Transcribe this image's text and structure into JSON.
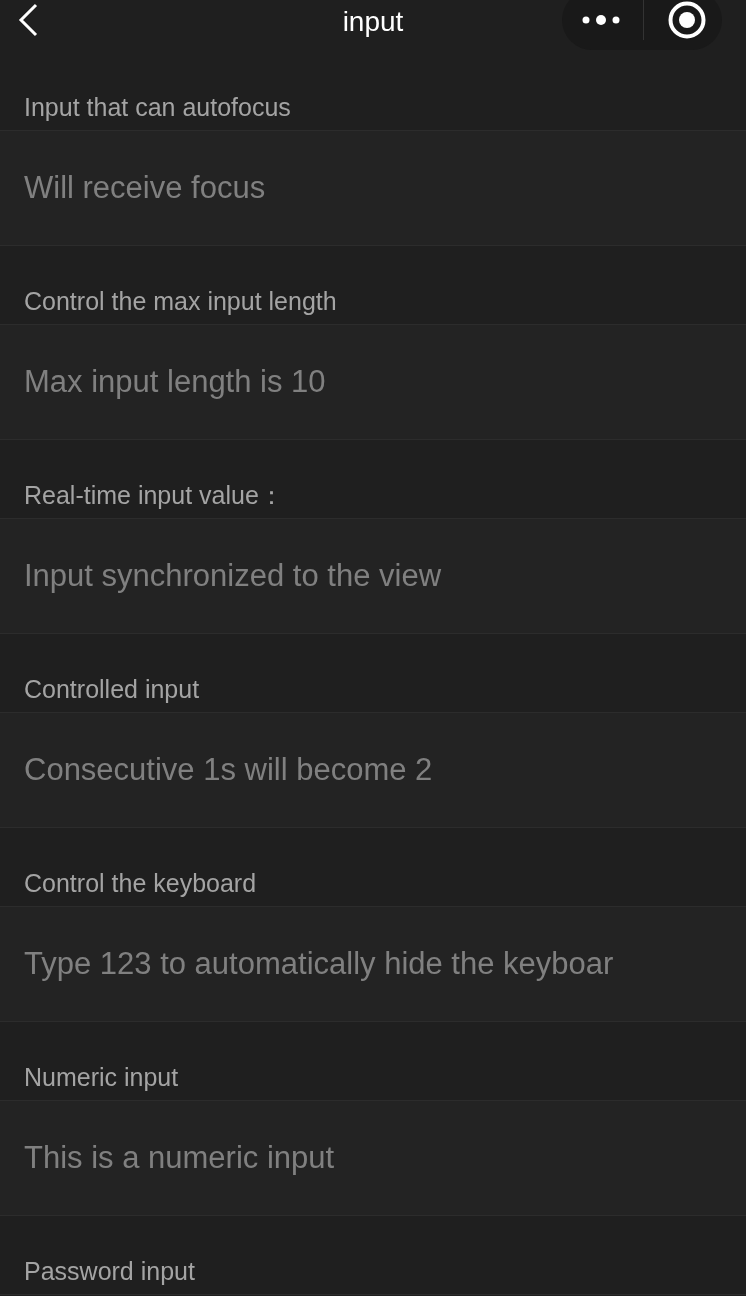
{
  "header": {
    "title": "input"
  },
  "sections": [
    {
      "label": "Input that can autofocus",
      "placeholder": "Will receive focus"
    },
    {
      "label": "Control the max input length",
      "placeholder": "Max input length is 10"
    },
    {
      "label": "Real-time input value：",
      "placeholder": "Input synchronized to the view"
    },
    {
      "label": "Controlled input",
      "placeholder": "Consecutive 1s will become 2"
    },
    {
      "label": "Control the keyboard",
      "placeholder": "Type 123 to automatically hide the keyboar"
    },
    {
      "label": "Numeric input",
      "placeholder": "This is a numeric input"
    },
    {
      "label": "Password input"
    }
  ]
}
